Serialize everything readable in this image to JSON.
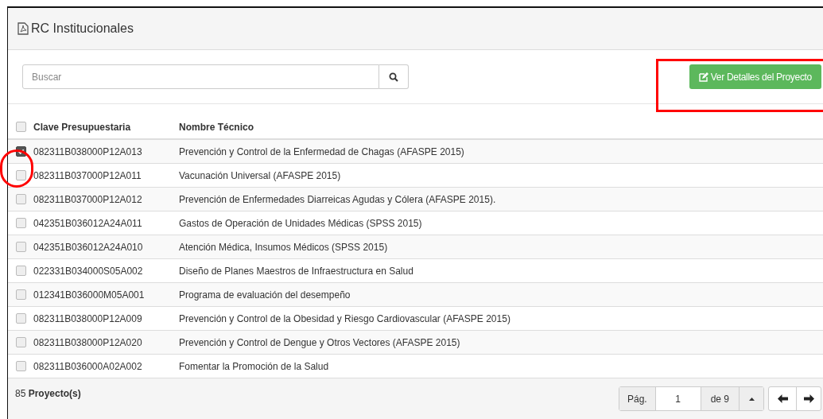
{
  "panel": {
    "title": "RC Institucionales"
  },
  "search": {
    "placeholder": "Buscar"
  },
  "details_button": {
    "label": "Ver Detalles del Proyecto"
  },
  "table": {
    "columns": [
      "Clave Presupuestaria",
      "Nombre Técnico"
    ],
    "all_checked": false,
    "rows": [
      {
        "clave": "082311B038000P12A013",
        "nombre": "Prevención y Control de la Enfermedad de Chagas (AFASPE 2015)",
        "checked": true
      },
      {
        "clave": "082311B037000P12A011",
        "nombre": "Vacunación Universal (AFASPE 2015)",
        "checked": false
      },
      {
        "clave": "082311B037000P12A012",
        "nombre": "Prevención de Enfermedades Diarreicas Agudas y Cólera (AFASPE 2015).",
        "checked": false
      },
      {
        "clave": "042351B036012A24A011",
        "nombre": "Gastos de Operación de Unidades Médicas (SPSS 2015)",
        "checked": false
      },
      {
        "clave": "042351B036012A24A010",
        "nombre": "Atención Médica, Insumos Médicos (SPSS 2015)",
        "checked": false
      },
      {
        "clave": "022331B034000S05A002",
        "nombre": "Diseño de Planes Maestros de Infraestructura en Salud",
        "checked": false
      },
      {
        "clave": "012341B036000M05A001",
        "nombre": "Programa de evaluación del desempeño",
        "checked": false
      },
      {
        "clave": "082311B038000P12A009",
        "nombre": "Prevención y Control de la Obesidad y Riesgo Cardiovascular (AFASPE 2015)",
        "checked": false
      },
      {
        "clave": "082311B038000P12A020",
        "nombre": "Prevención y Control de Dengue y Otros Vectores (AFASPE 2015)",
        "checked": false
      },
      {
        "clave": "082311B036000A02A002",
        "nombre": "Fomentar la Promoción de la Salud",
        "checked": false
      }
    ]
  },
  "footer": {
    "count": "85 **Proyecto(s)**",
    "page_label": "Pág.",
    "page_value": "1",
    "page_total": "de 9"
  }
}
